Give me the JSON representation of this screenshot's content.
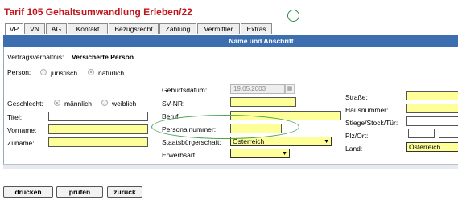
{
  "title": "Tarif 105 Gehaltsumwandlung Erleben/22",
  "tabs": [
    {
      "label": "VP",
      "active": true
    },
    {
      "label": "VN"
    },
    {
      "label": "AG"
    },
    {
      "label": "Kontakt"
    },
    {
      "label": "Bezugsrecht"
    },
    {
      "label": "Zahlung"
    },
    {
      "label": "Vermittler"
    },
    {
      "label": "Extras"
    }
  ],
  "section": {
    "header": "Name und Anschrift"
  },
  "vertrag": {
    "label": "Vertragsverhältnis:",
    "value": "Versicherte Person"
  },
  "person": {
    "label": "Person:",
    "option_juristisch": "juristisch",
    "option_natuerlich": "natürlich",
    "selected": "natürlich"
  },
  "geschlecht": {
    "label": "Geschlecht:",
    "option_maennlich": "männlich",
    "option_weiblich": "weiblich",
    "selected": "männlich"
  },
  "fields": {
    "titel": {
      "label": "Titel:",
      "value": ""
    },
    "vorname": {
      "label": "Vorname:",
      "value": ""
    },
    "zuname": {
      "label": "Zuname:",
      "value": ""
    },
    "geburtsdatum": {
      "label": "Geburtsdatum:",
      "value": "19.05.2003"
    },
    "svnr": {
      "label": "SV-NR:",
      "value": ""
    },
    "beruf": {
      "label": "Beruf:",
      "value": ""
    },
    "personalnummer": {
      "label": "Personalnummer:",
      "value": ""
    },
    "staatsbuergerschaft": {
      "label": "Staatsbürgerschaft:",
      "value": "Österreich"
    },
    "erwerbsart": {
      "label": "Erwerbsart:",
      "value": ""
    },
    "strasse": {
      "label": "Straße:",
      "value": ""
    },
    "hausnummer": {
      "label": "Hausnummer:",
      "value": ""
    },
    "stiege": {
      "label": "Stiege/Stock/Tür:",
      "value": ""
    },
    "plzort": {
      "label": "Plz/Ort:",
      "plz": "",
      "ort": ""
    },
    "land": {
      "label": "Land:",
      "value": "Österreich"
    }
  },
  "buttons": {
    "drucken": "drucken",
    "pruefen": "prüfen",
    "zurueck": "zurück"
  },
  "colors": {
    "title": "#c0161c",
    "header": "#3d6fb0",
    "required_field": "#ffff99",
    "annotation": "#4aa35a"
  },
  "icons": {
    "calendar": "calendar-icon",
    "dropdown": "chevron-down-icon"
  }
}
